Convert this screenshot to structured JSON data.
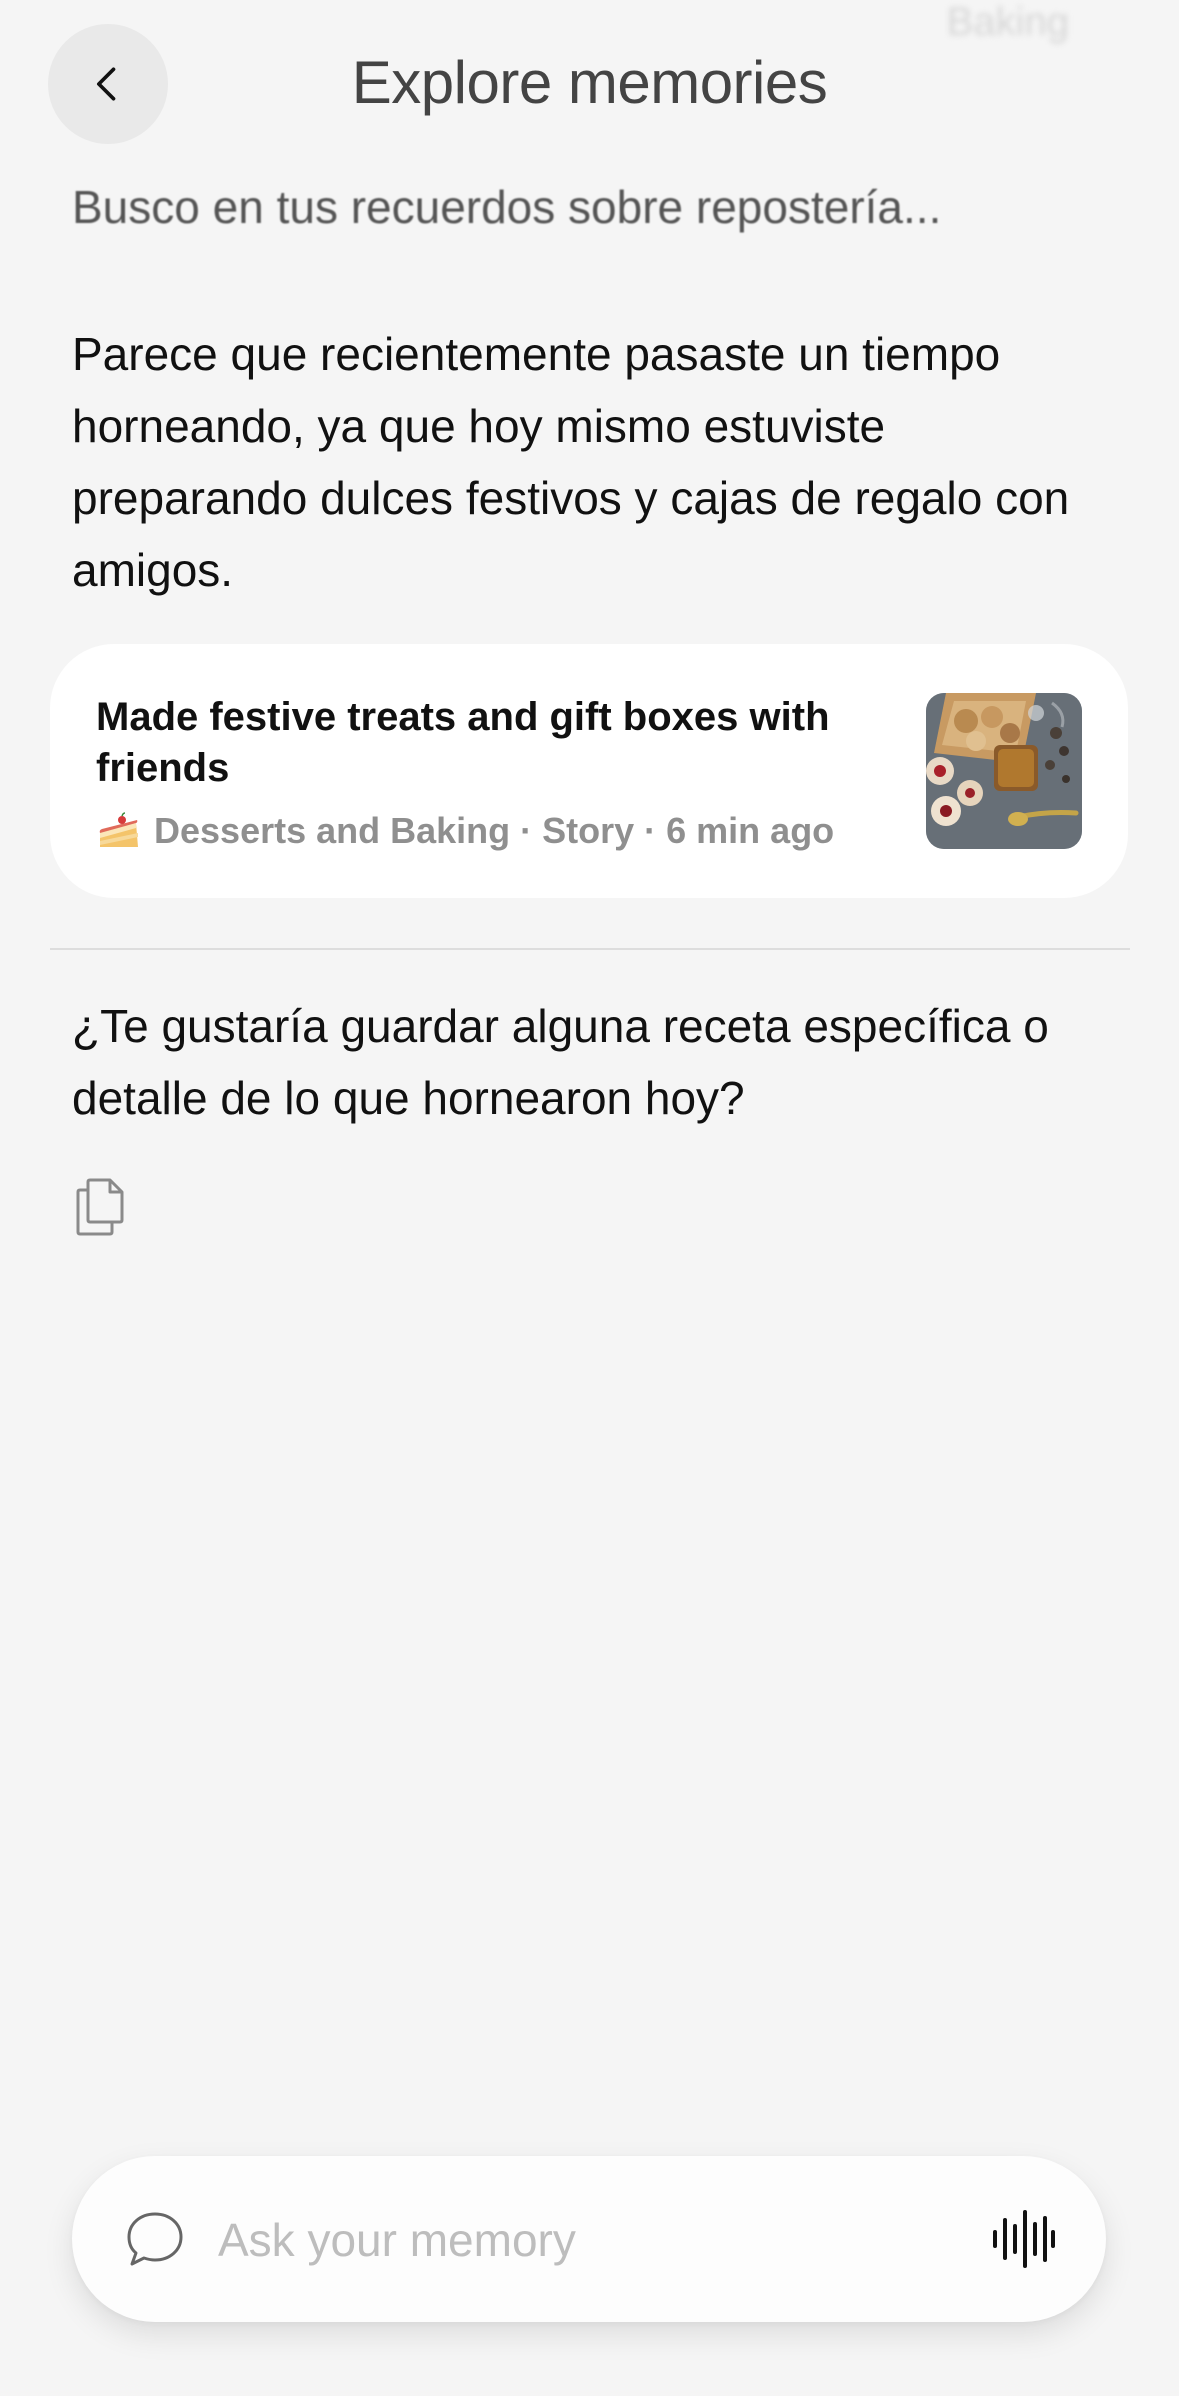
{
  "header": {
    "faded_text": "Baking",
    "title": "Explore memories"
  },
  "conversation": {
    "thinking": "Busco en tus recuerdos sobre repostería...",
    "answer": "Parece que recientemente pasaste un tiempo horneando, ya que hoy mismo estuviste preparando dulces festivos y cajas de regalo con amigos.",
    "memory_card": {
      "title": "Made festive treats and gift boxes with friends",
      "category_icon": "cake-icon",
      "meta": "Desserts and Baking · Story · 6 min ago"
    },
    "followup": "¿Te gustaría guardar alguna receta específica o detalle de lo que hornearon hoy?"
  },
  "input_bar": {
    "placeholder": "Ask your memory"
  },
  "icons": {
    "back": "chevron-left-icon",
    "copy": "copy-icon",
    "chat": "chat-bubble-icon",
    "voice": "waveform-icon"
  }
}
